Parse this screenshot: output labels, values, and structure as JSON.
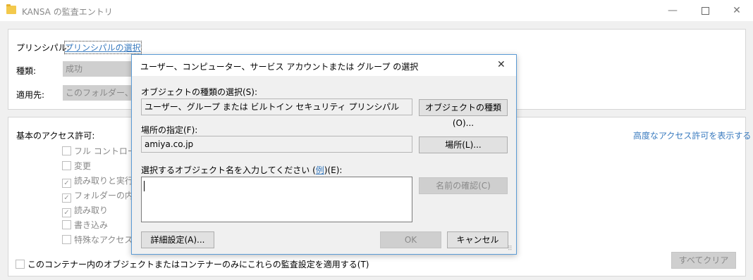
{
  "window": {
    "title": "KANSA の監査エントリ",
    "minimize": "—",
    "close": "✕"
  },
  "principal": {
    "label": "プリンシパル:",
    "link": "プリンシパルの選択"
  },
  "type": {
    "label": "種類:",
    "value": "成功"
  },
  "applies": {
    "label": "適用先:",
    "value": "このフォルダー、サブ"
  },
  "permissions": {
    "heading": "基本のアクセス許可:",
    "advanced_link": "高度なアクセス許可を表示する",
    "items": [
      {
        "label": "フル コントロール",
        "checked": false
      },
      {
        "label": "変更",
        "checked": false
      },
      {
        "label": "読み取りと実行",
        "checked": true
      },
      {
        "label": "フォルダーの内容",
        "checked": true
      },
      {
        "label": "読み取り",
        "checked": true
      },
      {
        "label": "書き込み",
        "checked": false
      },
      {
        "label": "特殊なアクセス許",
        "checked": false
      }
    ],
    "apply_only": "このコンテナー内のオブジェクトまたはコンテナーのみにこれらの監査設定を適用する(T)",
    "clear_all": "すべてクリア"
  },
  "dialog": {
    "title": "ユーザー、コンピューター、サービス アカウントまたは グループ の選択",
    "close": "✕",
    "object_type_label": "オブジェクトの種類の選択(S):",
    "object_type_value": "ユーザー、グループ または ビルトイン セキュリティ プリンシパル",
    "object_type_button": "オブジェクトの種類(O)...",
    "location_label": "場所の指定(F):",
    "location_value": "amiya.co.jp",
    "location_button": "場所(L)...",
    "name_label_prefix": "選択するオブジェクト名を入力してください (",
    "name_label_link": "例",
    "name_label_suffix": ")(E):",
    "name_value": "",
    "check_names_button": "名前の確認(C)",
    "advanced_button": "詳細設定(A)...",
    "ok_button": "OK",
    "cancel_button": "キャンセル"
  }
}
